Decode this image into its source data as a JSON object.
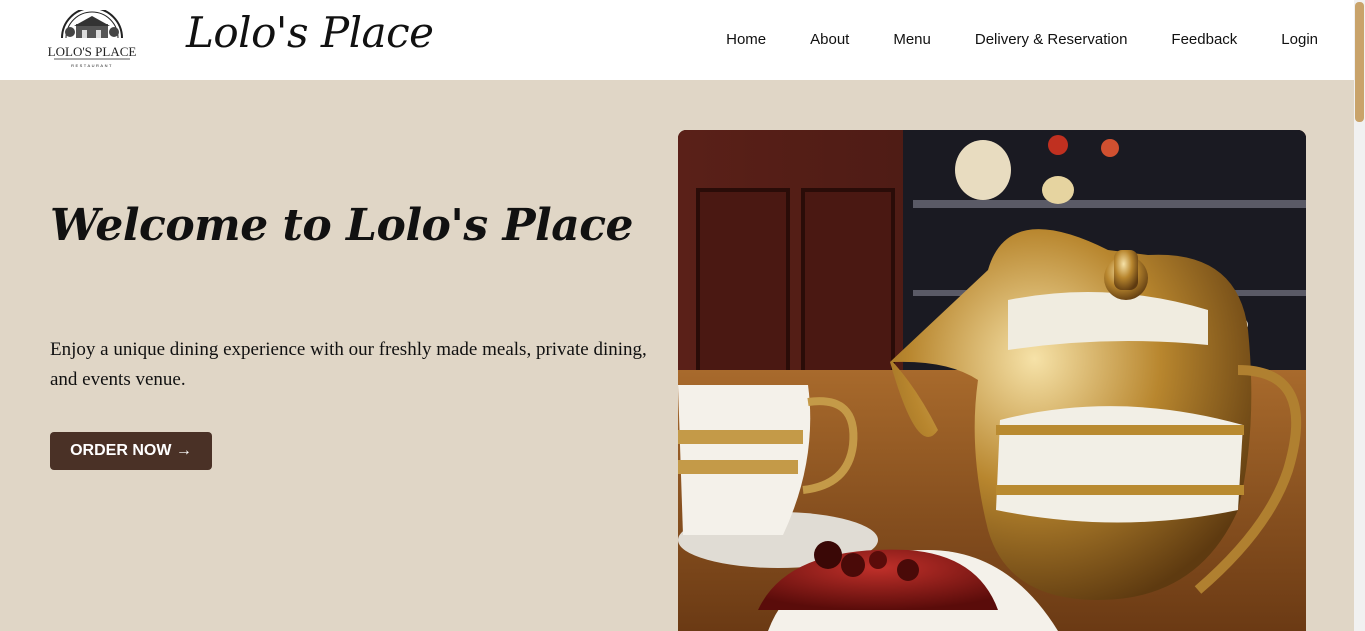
{
  "header": {
    "logo_text": "LOLO'S PLACE",
    "logo_subtext": "RESTAURANT",
    "brand_title": "Lolo's Place"
  },
  "nav": {
    "items": [
      "Home",
      "About",
      "Menu",
      "Delivery & Reservation",
      "Feedback",
      "Login"
    ]
  },
  "hero": {
    "title": "Welcome to Lolo's Place",
    "description": "Enjoy a unique dining experience with our freshly made meals, private dining, and events venue.",
    "cta_label": "ORDER NOW →",
    "image_icon": "teapot-cake-photo"
  },
  "colors": {
    "page_bg": "#e0d6c6",
    "header_bg": "#ffffff",
    "button_bg": "#4a3126",
    "scroll_thumb": "#c9a36a"
  }
}
